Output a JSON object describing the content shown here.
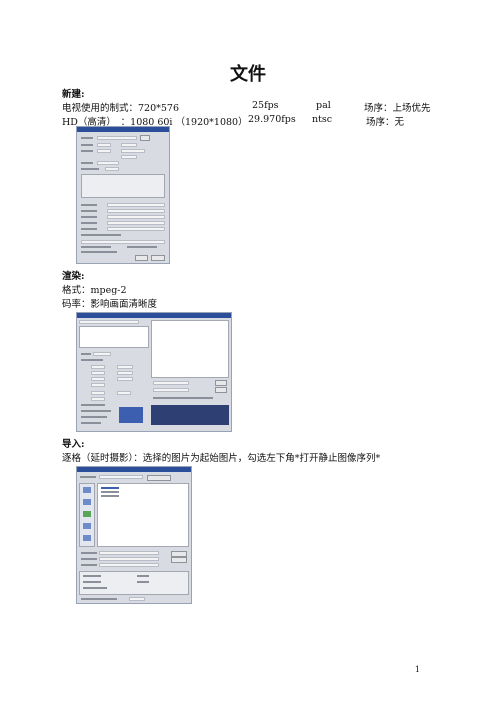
{
  "page": {
    "title": "文件",
    "page_number": "1"
  },
  "sections": {
    "new": {
      "heading": "新建:",
      "line1": {
        "label": "电视使用的制式：720*576",
        "fps": "25fps",
        "standard": "pal",
        "field": "场序：上场优先"
      },
      "line2": {
        "label": "HD（高清）　：1080 60i （1920*1080）",
        "fps": "29.970fps",
        "standard": "ntsc",
        "field": "场序：无"
      }
    },
    "render": {
      "heading": "渲染:",
      "format": "格式：mpeg-2",
      "bitrate": "码率：影响画面清晰度"
    },
    "import": {
      "heading": "导入:",
      "desc": "逐格（延时摄影）：选择的图片为起始图片，勾选左下角*打开静止图像序列*"
    }
  }
}
